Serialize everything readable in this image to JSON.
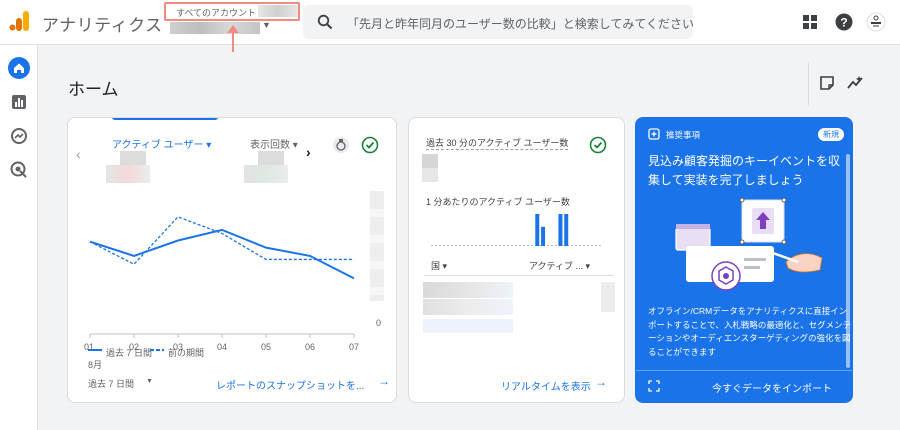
{
  "header": {
    "app_name": "アナリティクス",
    "account_breadcrumb": "すべてのアカウント ›",
    "search_placeholder": "「先月と昨年同月のユーザー数の比較」と検索してみてください"
  },
  "page": {
    "title": "ホーム"
  },
  "overview_card": {
    "metric1_label": "アクティブ ユーザー ▾",
    "metric2_label": "表示回数 ▾",
    "x_ticks": [
      "01",
      "02",
      "03",
      "04",
      "05",
      "06",
      "07"
    ],
    "x_month": "8月",
    "y_zero": "0",
    "legend_current": "過去 7 日間",
    "legend_previous": "前の期間",
    "date_range": "過去 7 日間",
    "footer_link": "レポートのスナップショットを..."
  },
  "realtime_card": {
    "title": "過去 30 分のアクティブ ユーザー数",
    "per_minute_label": "1 分あたりのアクティブ ユーザー数",
    "col_country": "国 ▾",
    "col_active": "アクティブ ... ▾",
    "footer_link": "リアルタイムを表示"
  },
  "recommendation_card": {
    "label": "推奨事項",
    "badge": "新規",
    "title": "見込み顧客発掘のキーイベントを収集して実装を完了しましょう",
    "body": "オフライン/CRMデータをアナリティクスに直接インポートすることで、入札戦略の最適化と、セグメンテーションやオーディエンスターゲティングの強化を図ることができます",
    "footer_button": "今すぐデータをインポート"
  },
  "chart_data": {
    "type": "line",
    "categories": [
      "01",
      "02",
      "03",
      "04",
      "05",
      "06",
      "07"
    ],
    "series": [
      {
        "name": "過去 7 日間",
        "values": [
          0.78,
          0.66,
          0.79,
          0.88,
          0.73,
          0.66,
          0.47
        ],
        "color": "#1a73e8"
      },
      {
        "name": "前の期間",
        "values": [
          0.78,
          0.59,
          0.99,
          0.85,
          0.63,
          0.63,
          0.63
        ],
        "color": "#1a73e8"
      }
    ],
    "ylim": [
      0,
      1.2
    ],
    "xlabel": "",
    "ylabel": ""
  },
  "realtime_bars": [
    0,
    0,
    0,
    0,
    0,
    0,
    0,
    0,
    0,
    0,
    0,
    0,
    0,
    0,
    0,
    0,
    0,
    0,
    1,
    0.6,
    0,
    0,
    1,
    1,
    0,
    0,
    0,
    0,
    0,
    0
  ],
  "colors": {
    "accent": "#1a73e8",
    "success": "#188038"
  }
}
